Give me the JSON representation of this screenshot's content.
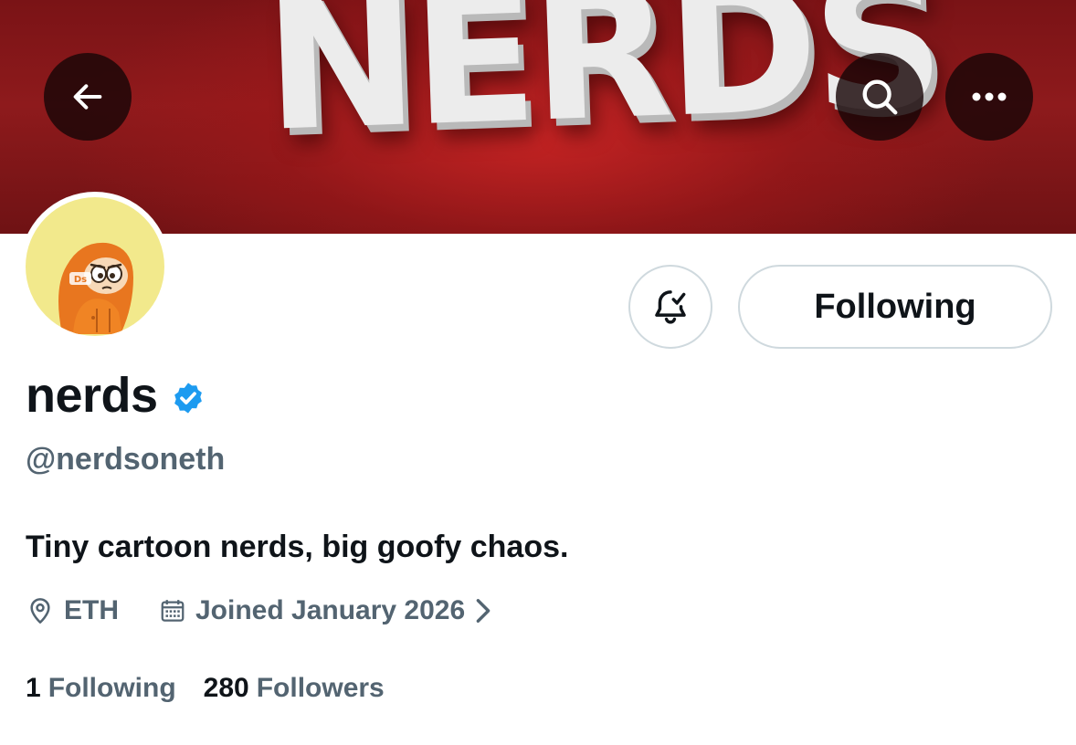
{
  "header": {
    "banner_text": "NERDS"
  },
  "profile": {
    "name": "nerds",
    "handle": "@nerdsoneth",
    "bio": "Tiny cartoon nerds, big goofy chaos.",
    "location": "ETH",
    "joined": "Joined January 2026",
    "avatar_badge_text": "Ds"
  },
  "actions": {
    "follow_label": "Following"
  },
  "stats": {
    "following_count": "1",
    "following_label": "Following",
    "followers_count": "280",
    "followers_label": "Followers"
  },
  "icons": {
    "back": "back-arrow-icon",
    "search": "search-icon",
    "more": "more-options-icon",
    "bell": "notification-bell-icon",
    "verified": "verified-badge-icon",
    "location": "location-pin-icon",
    "calendar": "calendar-icon",
    "chevron": "chevron-right-icon"
  },
  "colors": {
    "text_primary": "#0f1419",
    "text_secondary": "#536471",
    "verified_blue": "#1d9bf0",
    "banner_red": "#a51c1f",
    "button_border": "#cfd9de"
  }
}
